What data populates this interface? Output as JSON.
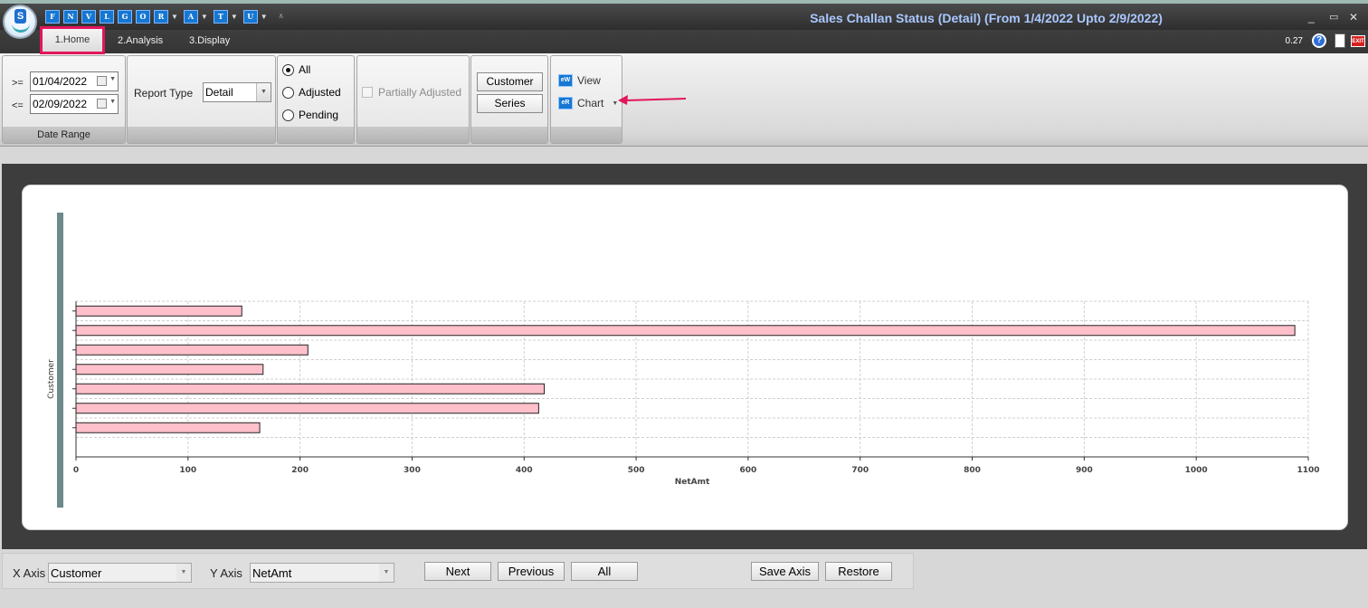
{
  "window": {
    "title": "Sales Challan Status (Detail)  (From 1/4/2022 Upto 2/9/2022)",
    "minimize": "_",
    "maximize": "▭",
    "close": "✕"
  },
  "quick_access": [
    {
      "letter": "F",
      "has_dropdown": false
    },
    {
      "letter": "N",
      "has_dropdown": false
    },
    {
      "letter": "V",
      "has_dropdown": false
    },
    {
      "letter": "L",
      "has_dropdown": false
    },
    {
      "letter": "G",
      "has_dropdown": false
    },
    {
      "letter": "O",
      "has_dropdown": false
    },
    {
      "letter": "R",
      "has_dropdown": true
    },
    {
      "letter": "A",
      "has_dropdown": true
    },
    {
      "letter": "T",
      "has_dropdown": true
    },
    {
      "letter": "U",
      "has_dropdown": true
    }
  ],
  "tabs": {
    "home": "1.Home",
    "analysis": "2.Analysis",
    "display": "3.Display"
  },
  "status": {
    "version": "0.27",
    "help": "?",
    "exit": "EXIT"
  },
  "date_range": {
    "from_op": ">=",
    "from_value": "01/04/2022",
    "to_op": "<=",
    "to_value": "02/09/2022",
    "group_label": "Date Range"
  },
  "report_type": {
    "label": "Report Type",
    "value": "Detail"
  },
  "filter": {
    "all": "All",
    "adjusted": "Adjusted",
    "pending": "Pending",
    "selected": "all"
  },
  "partially_adjusted": "Partially Adjusted",
  "group_buttons": {
    "customer": "Customer",
    "series": "Series"
  },
  "view_group": {
    "view": "View",
    "chart": "Chart",
    "view_icon": "eW",
    "chart_icon": "eR"
  },
  "colors": {
    "bar_fill": "#ffc0cb",
    "bar_stroke": "#222222",
    "annotation": "#e2165d"
  },
  "chart_data": {
    "type": "bar",
    "orientation": "horizontal",
    "categories": [
      "",
      "",
      "",
      "",
      "",
      "",
      ""
    ],
    "values": [
      148,
      1088,
      207,
      167,
      418,
      413,
      164
    ],
    "xlabel": "NetAmt",
    "ylabel": "Customer",
    "xlim": [
      0,
      1100
    ],
    "x_ticks": [
      "0",
      "100",
      "200",
      "300",
      "400",
      "500",
      "600",
      "700",
      "800",
      "900",
      "1000",
      "1100"
    ],
    "grid": true
  },
  "bottom": {
    "x_axis_label": "X Axis",
    "x_axis_value": "Customer",
    "y_axis_label": "Y Axis",
    "y_axis_value": "NetAmt",
    "next": "Next",
    "previous": "Previous",
    "all": "All",
    "save_axis": "Save Axis",
    "restore": "Restore"
  }
}
